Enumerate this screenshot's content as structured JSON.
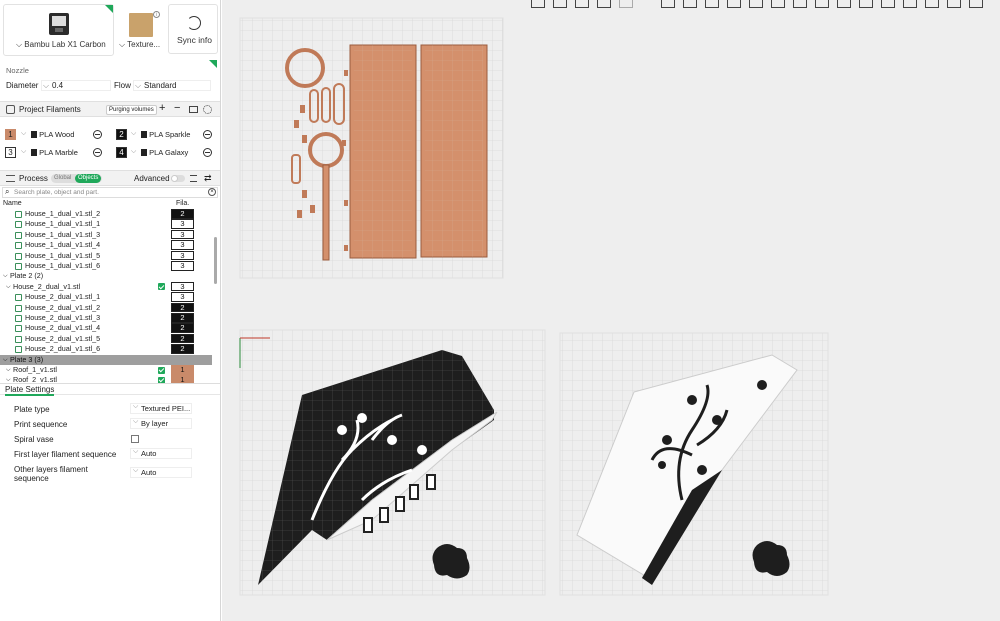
{
  "printer": {
    "name": "Bambu Lab X1 Carbon",
    "plate": "Texture...",
    "sync_label": "Sync info"
  },
  "nozzle": {
    "section": "Nozzle",
    "diameter_label": "Diameter",
    "diameter_value": "0.4",
    "flow_label": "Flow",
    "flow_value": "Standard"
  },
  "filaments": {
    "title": "Project Filaments",
    "purging_label": "Purging volumes",
    "items": [
      {
        "num": "1",
        "name": "PLA Wood",
        "color": "#c98a6a"
      },
      {
        "num": "2",
        "name": "PLA Sparkle",
        "color": "#111111"
      },
      {
        "num": "3",
        "name": "PLA Marble",
        "color": "#ffffff"
      },
      {
        "num": "4",
        "name": "PLA Galaxy",
        "color": "#111111"
      }
    ]
  },
  "process": {
    "title": "Process",
    "toggle_global": "Global",
    "toggle_objects": "Objects",
    "advanced_label": "Advanced",
    "search_placeholder": "Search plate, object and part.",
    "col_name": "Name",
    "col_fila": "Fila.",
    "rows": [
      {
        "name": "House_1_dual_v1.stl_2",
        "fila": "2",
        "style": "dark",
        "indent": 2
      },
      {
        "name": "House_1_dual_v1.stl_1",
        "fila": "3",
        "style": "",
        "indent": 2
      },
      {
        "name": "House_1_dual_v1.stl_3",
        "fila": "3",
        "style": "",
        "indent": 2
      },
      {
        "name": "House_1_dual_v1.stl_4",
        "fila": "3",
        "style": "",
        "indent": 2
      },
      {
        "name": "House_1_dual_v1.stl_5",
        "fila": "3",
        "style": "",
        "indent": 2
      },
      {
        "name": "House_1_dual_v1.stl_6",
        "fila": "3",
        "style": "",
        "indent": 2
      },
      {
        "name": "Plate 2 (2)",
        "fila": "",
        "style": "",
        "indent": 0
      },
      {
        "name": "House_2_dual_v1.stl",
        "fila": "3",
        "style": "",
        "indent": 1,
        "check": true
      },
      {
        "name": "House_2_dual_v1.stl_1",
        "fila": "3",
        "style": "",
        "indent": 2
      },
      {
        "name": "House_2_dual_v1.stl_2",
        "fila": "2",
        "style": "dark",
        "indent": 2
      },
      {
        "name": "House_2_dual_v1.stl_3",
        "fila": "2",
        "style": "dark",
        "indent": 2
      },
      {
        "name": "House_2_dual_v1.stl_4",
        "fila": "2",
        "style": "dark",
        "indent": 2
      },
      {
        "name": "House_2_dual_v1.stl_5",
        "fila": "2",
        "style": "dark",
        "indent": 2
      },
      {
        "name": "House_2_dual_v1.stl_6",
        "fila": "2",
        "style": "dark",
        "indent": 2
      },
      {
        "name": "Plate 3 (3)",
        "fila": "",
        "style": "",
        "indent": 0,
        "highlight": true
      },
      {
        "name": "Roof_1_v1.stl",
        "fila": "1",
        "style": "wood",
        "indent": 1,
        "check": true
      },
      {
        "name": "Roof_2_v1.stl",
        "fila": "1",
        "style": "wood",
        "indent": 1,
        "check": true
      }
    ]
  },
  "plate_settings": {
    "title": "Plate Settings",
    "items": [
      {
        "label": "Plate type",
        "value": "Textured PEI..."
      },
      {
        "label": "Print sequence",
        "value": "By layer"
      },
      {
        "label": "Spiral vase",
        "value": ""
      },
      {
        "label": "First layer filament sequence",
        "value": "Auto"
      },
      {
        "label": "Other layers filament sequence",
        "value": "Auto"
      }
    ]
  },
  "colors": {
    "accent": "#1fa85a",
    "wood": "#c98a6a",
    "dark": "#111111"
  }
}
